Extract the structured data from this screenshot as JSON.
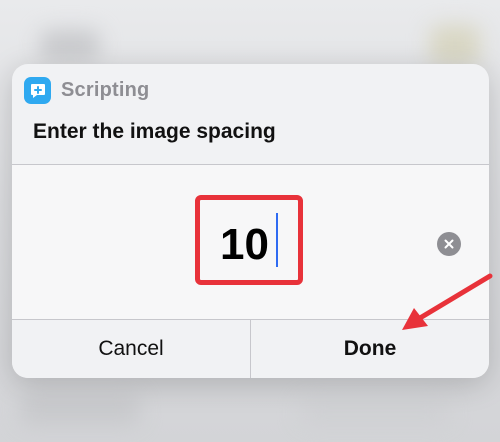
{
  "dialog": {
    "app_name": "Scripting",
    "app_icon": "quote-plus-icon",
    "prompt": "Enter the image spacing",
    "input_value": "10",
    "cancel_label": "Cancel",
    "done_label": "Done"
  },
  "annotations": {
    "highlight_color": "#e8323a",
    "arrow_color": "#e8323a"
  },
  "colors": {
    "app_icon_bg": "#2fa9f0",
    "caret": "#2f6bf2"
  }
}
